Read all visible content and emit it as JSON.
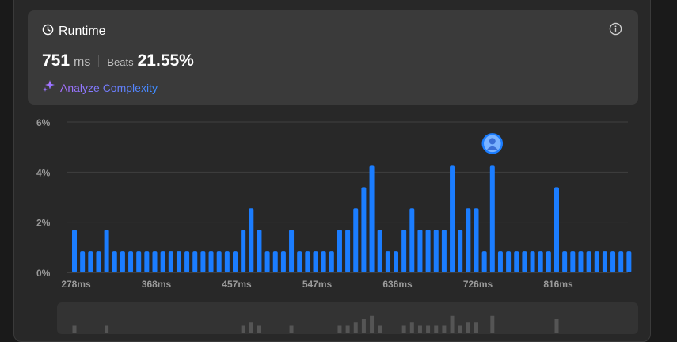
{
  "card": {
    "title": "Runtime",
    "runtime_value": "751",
    "runtime_unit": "ms",
    "beats_label": "Beats",
    "beats_value": "21.55%",
    "analyze_label": "Analyze Complexity"
  },
  "icons": {
    "clock": "clock-icon",
    "info": "info-icon",
    "sparkle": "sparkle-icon",
    "avatar": "user-avatar-icon"
  },
  "colors": {
    "bar": "#1b7dff",
    "background": "#282828",
    "card": "#3a3a3a",
    "grid": "#3f3f3f",
    "overview_bar": "#555555"
  },
  "chart_data": {
    "type": "bar",
    "ylim": [
      0,
      6
    ],
    "y_ticks": [
      "6%",
      "4%",
      "2%",
      "0%"
    ],
    "x_tick_labels": [
      "278ms",
      "368ms",
      "457ms",
      "547ms",
      "636ms",
      "726ms",
      "816ms"
    ],
    "values": [
      1.7,
      0.85,
      0.85,
      0.85,
      1.7,
      0.85,
      0.85,
      0.85,
      0.85,
      0.85,
      0.85,
      0.85,
      0.85,
      0.85,
      0.85,
      0.85,
      0.85,
      0.85,
      0.85,
      0.85,
      0.85,
      1.7,
      2.55,
      1.7,
      0.85,
      0.85,
      0.85,
      1.7,
      0.85,
      0.85,
      0.85,
      0.85,
      0.85,
      1.7,
      1.7,
      2.55,
      3.4,
      4.25,
      1.7,
      0.85,
      0.85,
      1.7,
      2.55,
      1.7,
      1.7,
      1.7,
      1.7,
      4.25,
      1.7,
      2.55,
      2.55,
      0.85,
      4.25,
      0.85,
      0.85,
      0.85,
      0.85,
      0.85,
      0.85,
      0.85,
      3.4,
      0.85,
      0.85,
      0.85,
      0.85,
      0.85,
      0.85,
      0.85,
      0.85,
      0.85
    ],
    "highlight_index": 52,
    "grid": true
  }
}
